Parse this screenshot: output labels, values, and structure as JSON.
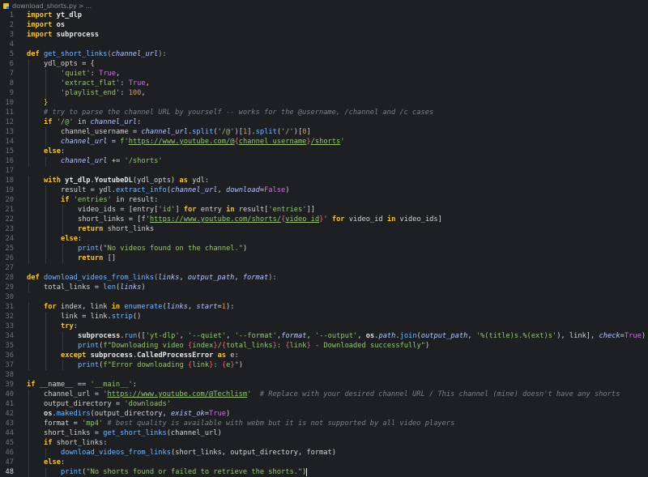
{
  "breadcrumb": {
    "file": "download_shorts.py",
    "separator": ">",
    "rest": "..."
  },
  "active_line": 48,
  "code_lines": [
    {
      "n": "1",
      "indent": 0,
      "tokens": [
        [
          "kw",
          "import"
        ],
        [
          "nm",
          " "
        ],
        [
          "mod",
          "yt_dlp"
        ]
      ]
    },
    {
      "n": "2",
      "indent": 0,
      "tokens": [
        [
          "kw",
          "import"
        ],
        [
          "nm",
          " "
        ],
        [
          "mod",
          "os"
        ]
      ]
    },
    {
      "n": "3",
      "indent": 0,
      "tokens": [
        [
          "kw",
          "import"
        ],
        [
          "nm",
          " "
        ],
        [
          "mod",
          "subprocess"
        ]
      ]
    },
    {
      "n": "4",
      "indent": 0,
      "tokens": []
    },
    {
      "n": "5",
      "indent": 0,
      "tokens": [
        [
          "kw",
          "def"
        ],
        [
          "nm",
          " "
        ],
        [
          "fn",
          "get_short_links"
        ],
        [
          "pun",
          "("
        ],
        [
          "param",
          "channel_url"
        ],
        [
          "pun",
          "):"
        ]
      ]
    },
    {
      "n": "6",
      "indent": 1,
      "tokens": [
        [
          "nm",
          "ydl_opts = {"
        ]
      ]
    },
    {
      "n": "7",
      "indent": 2,
      "tokens": [
        [
          "str",
          "'quiet'"
        ],
        [
          "nm",
          ": "
        ],
        [
          "const",
          "True"
        ],
        [
          "nm",
          ","
        ]
      ]
    },
    {
      "n": "8",
      "indent": 2,
      "tokens": [
        [
          "str",
          "'extract_flat'"
        ],
        [
          "nm",
          ": "
        ],
        [
          "const",
          "True"
        ],
        [
          "nm",
          ","
        ]
      ]
    },
    {
      "n": "9",
      "indent": 2,
      "tokens": [
        [
          "str",
          "'playlist_end'"
        ],
        [
          "nm",
          ": "
        ],
        [
          "num",
          "100"
        ],
        [
          "nm",
          ","
        ]
      ]
    },
    {
      "n": "10",
      "indent": 1,
      "tokens": [
        [
          "br",
          "}"
        ]
      ]
    },
    {
      "n": "11",
      "indent": 1,
      "tokens": [
        [
          "com",
          "# try to parse the channel URL by yourself -- works for the @username, /channel and /c cases"
        ]
      ]
    },
    {
      "n": "12",
      "indent": 1,
      "tokens": [
        [
          "kw",
          "if"
        ],
        [
          "nm",
          " "
        ],
        [
          "str",
          "'/@'"
        ],
        [
          "nm",
          " in "
        ],
        [
          "param",
          "channel_url"
        ],
        [
          "nm",
          ":"
        ]
      ]
    },
    {
      "n": "13",
      "indent": 2,
      "tokens": [
        [
          "nm",
          "channel_username = "
        ],
        [
          "param",
          "channel_url"
        ],
        [
          "nm",
          "."
        ],
        [
          "fn",
          "split"
        ],
        [
          "nm",
          "("
        ],
        [
          "str",
          "'/@'"
        ],
        [
          "nm",
          ")["
        ],
        [
          "num",
          "1"
        ],
        [
          "nm",
          "]."
        ],
        [
          "fn",
          "split"
        ],
        [
          "nm",
          "("
        ],
        [
          "str",
          "'/'"
        ],
        [
          "nm",
          ")["
        ],
        [
          "num",
          "0"
        ],
        [
          "nm",
          "]"
        ]
      ]
    },
    {
      "n": "14",
      "indent": 2,
      "tokens": [
        [
          "param",
          "channel_url"
        ],
        [
          "nm",
          " = "
        ],
        [
          "str",
          "f'"
        ],
        [
          "ul",
          "https://www.youtube.com/@"
        ],
        [
          "fmt",
          "{"
        ],
        [
          "ul",
          "channel_username"
        ],
        [
          "fmt",
          "}"
        ],
        [
          "ul",
          "/shorts"
        ],
        [
          "str",
          "'"
        ]
      ]
    },
    {
      "n": "15",
      "indent": 1,
      "tokens": [
        [
          "kw",
          "else"
        ],
        [
          "nm",
          ":"
        ]
      ]
    },
    {
      "n": "16",
      "indent": 2,
      "tokens": [
        [
          "param",
          "channel_url"
        ],
        [
          "nm",
          " += "
        ],
        [
          "str",
          "'/shorts'"
        ]
      ]
    },
    {
      "n": "17",
      "indent": 0,
      "tokens": []
    },
    {
      "n": "18",
      "indent": 1,
      "tokens": [
        [
          "kw",
          "with"
        ],
        [
          "nm",
          " "
        ],
        [
          "mod",
          "yt_dlp"
        ],
        [
          "nm",
          "."
        ],
        [
          "mod",
          "YoutubeDL"
        ],
        [
          "nm",
          "(ydl_opts) "
        ],
        [
          "kw",
          "as"
        ],
        [
          "nm",
          " ydl:"
        ]
      ]
    },
    {
      "n": "19",
      "indent": 2,
      "tokens": [
        [
          "nm",
          "result = ydl."
        ],
        [
          "fn",
          "extract_info"
        ],
        [
          "nm",
          "("
        ],
        [
          "param",
          "channel_url"
        ],
        [
          "nm",
          ", "
        ],
        [
          "kwarg",
          "download"
        ],
        [
          "nm",
          "="
        ],
        [
          "const",
          "False"
        ],
        [
          "nm",
          ")"
        ]
      ]
    },
    {
      "n": "20",
      "indent": 2,
      "tokens": [
        [
          "kw",
          "if"
        ],
        [
          "nm",
          " "
        ],
        [
          "str",
          "'entries'"
        ],
        [
          "nm",
          " in result:"
        ]
      ]
    },
    {
      "n": "21",
      "indent": 3,
      "tokens": [
        [
          "nm",
          "video_ids = [entry["
        ],
        [
          "str",
          "'id'"
        ],
        [
          "nm",
          "] "
        ],
        [
          "kw",
          "for"
        ],
        [
          "nm",
          " entry "
        ],
        [
          "kw",
          "in"
        ],
        [
          "nm",
          " result["
        ],
        [
          "str",
          "'entries'"
        ],
        [
          "nm",
          "]]"
        ]
      ]
    },
    {
      "n": "22",
      "indent": 3,
      "tokens": [
        [
          "nm",
          "short_links = [f"
        ],
        [
          "str",
          "'"
        ],
        [
          "ul",
          "https://www.youtube.com/shorts/"
        ],
        [
          "fmt",
          "{"
        ],
        [
          "ul",
          "video_id"
        ],
        [
          "fmt",
          "}"
        ],
        [
          "str",
          "'"
        ],
        [
          "nm",
          " "
        ],
        [
          "kw",
          "for"
        ],
        [
          "nm",
          " video_id "
        ],
        [
          "kw",
          "in"
        ],
        [
          "nm",
          " video_ids]"
        ]
      ]
    },
    {
      "n": "23",
      "indent": 3,
      "tokens": [
        [
          "kw",
          "return"
        ],
        [
          "nm",
          " short_links"
        ]
      ]
    },
    {
      "n": "24",
      "indent": 2,
      "tokens": [
        [
          "kw",
          "else"
        ],
        [
          "nm",
          ":"
        ]
      ]
    },
    {
      "n": "25",
      "indent": 3,
      "tokens": [
        [
          "fn",
          "print"
        ],
        [
          "nm",
          "("
        ],
        [
          "str",
          "\"No videos found on the channel.\""
        ],
        [
          "nm",
          ")"
        ]
      ]
    },
    {
      "n": "26",
      "indent": 3,
      "tokens": [
        [
          "kw",
          "return"
        ],
        [
          "nm",
          " []"
        ]
      ]
    },
    {
      "n": "27",
      "indent": 0,
      "tokens": []
    },
    {
      "n": "28",
      "indent": 0,
      "tokens": [
        [
          "kw",
          "def"
        ],
        [
          "nm",
          " "
        ],
        [
          "fn",
          "download_videos_from_links"
        ],
        [
          "pun",
          "("
        ],
        [
          "param",
          "links"
        ],
        [
          "nm",
          ", "
        ],
        [
          "param",
          "output_path"
        ],
        [
          "nm",
          ", "
        ],
        [
          "param",
          "format"
        ],
        [
          "pun",
          "):"
        ]
      ]
    },
    {
      "n": "29",
      "indent": 1,
      "tokens": [
        [
          "nm",
          "total_links = "
        ],
        [
          "fn",
          "len"
        ],
        [
          "nm",
          "("
        ],
        [
          "param",
          "links"
        ],
        [
          "nm",
          ")"
        ]
      ]
    },
    {
      "n": "30",
      "indent": 0,
      "tokens": []
    },
    {
      "n": "31",
      "indent": 1,
      "tokens": [
        [
          "kw",
          "for"
        ],
        [
          "nm",
          " index, link "
        ],
        [
          "kw",
          "in"
        ],
        [
          "nm",
          " "
        ],
        [
          "fn",
          "enumerate"
        ],
        [
          "nm",
          "("
        ],
        [
          "param",
          "links"
        ],
        [
          "nm",
          ", "
        ],
        [
          "kwarg",
          "start"
        ],
        [
          "nm",
          "="
        ],
        [
          "num",
          "1"
        ],
        [
          "nm",
          "):"
        ]
      ]
    },
    {
      "n": "32",
      "indent": 2,
      "tokens": [
        [
          "nm",
          "link = link."
        ],
        [
          "fn",
          "strip"
        ],
        [
          "nm",
          "()"
        ]
      ]
    },
    {
      "n": "33",
      "indent": 2,
      "tokens": [
        [
          "kw",
          "try"
        ],
        [
          "nm",
          ":"
        ]
      ]
    },
    {
      "n": "34",
      "indent": 3,
      "tokens": [
        [
          "mod",
          "subprocess"
        ],
        [
          "nm",
          "."
        ],
        [
          "fn",
          "run"
        ],
        [
          "nm",
          "(["
        ],
        [
          "str",
          "'yt-dlp'"
        ],
        [
          "nm",
          ", "
        ],
        [
          "str",
          "'--quiet'"
        ],
        [
          "nm",
          ", "
        ],
        [
          "str",
          "'--format'"
        ],
        [
          "nm",
          ","
        ],
        [
          "param",
          "format"
        ],
        [
          "nm",
          ", "
        ],
        [
          "str",
          "'--output'"
        ],
        [
          "nm",
          ", "
        ],
        [
          "mod",
          "os"
        ],
        [
          "nm",
          "."
        ],
        [
          "param",
          "path"
        ],
        [
          "nm",
          "."
        ],
        [
          "fn",
          "join"
        ],
        [
          "nm",
          "("
        ],
        [
          "param",
          "output_path"
        ],
        [
          "nm",
          ", "
        ],
        [
          "str",
          "'%(title)s.%(ext)s'"
        ],
        [
          "nm",
          "), link], "
        ],
        [
          "kwarg",
          "check"
        ],
        [
          "nm",
          "="
        ],
        [
          "const",
          "True"
        ],
        [
          "nm",
          ")"
        ]
      ]
    },
    {
      "n": "35",
      "indent": 3,
      "tokens": [
        [
          "fn",
          "print"
        ],
        [
          "nm",
          "("
        ],
        [
          "str",
          "f\"Downloading video "
        ],
        [
          "fmt",
          "{"
        ],
        [
          "str",
          "index"
        ],
        [
          "fmt",
          "}"
        ],
        [
          "str",
          "/"
        ],
        [
          "fmt",
          "{"
        ],
        [
          "str",
          "total_links"
        ],
        [
          "fmt",
          "}"
        ],
        [
          "str",
          ": "
        ],
        [
          "fmt",
          "{"
        ],
        [
          "str",
          "link"
        ],
        [
          "fmt",
          "}"
        ],
        [
          "str",
          " - Downloaded successfully\""
        ],
        [
          "nm",
          ")"
        ]
      ]
    },
    {
      "n": "36",
      "indent": 2,
      "tokens": [
        [
          "kw",
          "except"
        ],
        [
          "nm",
          " "
        ],
        [
          "mod",
          "subprocess"
        ],
        [
          "nm",
          "."
        ],
        [
          "mod",
          "CalledProcessError"
        ],
        [
          "nm",
          " "
        ],
        [
          "kw",
          "as"
        ],
        [
          "nm",
          " e:"
        ]
      ]
    },
    {
      "n": "37",
      "indent": 3,
      "tokens": [
        [
          "fn",
          "print"
        ],
        [
          "nm",
          "("
        ],
        [
          "str",
          "f\"Error downloading "
        ],
        [
          "fmt",
          "{"
        ],
        [
          "str",
          "link"
        ],
        [
          "fmt",
          "}"
        ],
        [
          "str",
          ": "
        ],
        [
          "fmt",
          "{"
        ],
        [
          "str",
          "e"
        ],
        [
          "fmt",
          "}"
        ],
        [
          "str",
          "\""
        ],
        [
          "nm",
          ")"
        ]
      ]
    },
    {
      "n": "38",
      "indent": 0,
      "tokens": []
    },
    {
      "n": "39",
      "indent": 0,
      "tokens": [
        [
          "kw",
          "if"
        ],
        [
          "nm",
          " __name__ == "
        ],
        [
          "str",
          "'__main__'"
        ],
        [
          "nm",
          ":"
        ]
      ]
    },
    {
      "n": "40",
      "indent": 1,
      "tokens": [
        [
          "nm",
          "channel_url = "
        ],
        [
          "str",
          "'"
        ],
        [
          "ul",
          "https://www.youtube.com/@Techlism"
        ],
        [
          "str",
          "'"
        ],
        [
          "nm",
          "  "
        ],
        [
          "com",
          "# Replace with your desired channel URL / This channel (mine) doesn't have any shorts"
        ]
      ]
    },
    {
      "n": "41",
      "indent": 1,
      "tokens": [
        [
          "nm",
          "output_directory = "
        ],
        [
          "str",
          "'downloads'"
        ]
      ]
    },
    {
      "n": "42",
      "indent": 1,
      "tokens": [
        [
          "mod",
          "os"
        ],
        [
          "nm",
          "."
        ],
        [
          "fn",
          "makedirs"
        ],
        [
          "nm",
          "(output_directory, "
        ],
        [
          "kwarg",
          "exist_ok"
        ],
        [
          "nm",
          "="
        ],
        [
          "const",
          "True"
        ],
        [
          "nm",
          ")"
        ]
      ]
    },
    {
      "n": "43",
      "indent": 1,
      "tokens": [
        [
          "nm",
          "format = "
        ],
        [
          "str",
          "'mp4'"
        ],
        [
          "nm",
          " "
        ],
        [
          "com",
          "# best quality is available with webm but it is not supported by all video players"
        ]
      ]
    },
    {
      "n": "44",
      "indent": 1,
      "tokens": [
        [
          "nm",
          "short_links = "
        ],
        [
          "fn",
          "get_short_links"
        ],
        [
          "nm",
          "(channel_url)"
        ]
      ]
    },
    {
      "n": "45",
      "indent": 1,
      "tokens": [
        [
          "kw",
          "if"
        ],
        [
          "nm",
          " short_links:"
        ]
      ]
    },
    {
      "n": "46",
      "indent": 2,
      "tokens": [
        [
          "fn",
          "download_videos_from_links"
        ],
        [
          "nm",
          "(short_links, output_directory, format)"
        ]
      ]
    },
    {
      "n": "47",
      "indent": 1,
      "tokens": [
        [
          "kw",
          "else"
        ],
        [
          "nm",
          ":"
        ]
      ]
    },
    {
      "n": "48",
      "indent": 2,
      "tokens": [
        [
          "fn",
          "print"
        ],
        [
          "br",
          "("
        ],
        [
          "str",
          "\"No shorts found or failed to retrieve the shorts.\""
        ],
        [
          "br",
          ")"
        ]
      ]
    }
  ],
  "colors": {
    "background": "#1e1f22",
    "keyword": "#f0c54a",
    "string": "#98c379",
    "function": "#79b8ff",
    "comment": "#7a8089"
  }
}
